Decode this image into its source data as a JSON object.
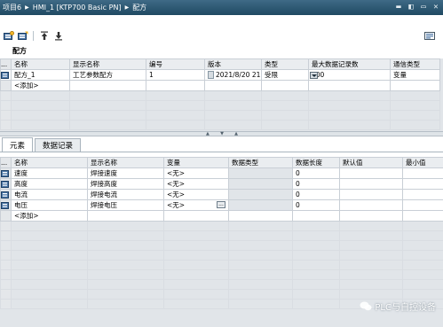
{
  "breadcrumb": {
    "items": [
      "项目6",
      "HMI_1 [KTP700 Basic PN]",
      "配方"
    ]
  },
  "window_controls": {
    "minimize": "▬",
    "restore": "◧",
    "maximize": "▭",
    "close": "✕"
  },
  "toolbar": {
    "buttons": [
      {
        "icon": "add-recipe-icon"
      },
      {
        "icon": "add-element-icon"
      },
      {
        "icon": "move-up-icon"
      },
      {
        "icon": "move-down-icon"
      }
    ]
  },
  "recipes": {
    "section_title": "配方",
    "columns": [
      "...",
      "名称",
      "显示名称",
      "编号",
      "版本",
      "类型",
      "最大数据记录数",
      "通信类型"
    ],
    "rows": [
      {
        "name": "配方_1",
        "display_name": "工艺参数配方",
        "number": "1",
        "version": "2021/8/20 21:1...",
        "type": "受限",
        "max_records": "100",
        "comm_type": "变量"
      }
    ],
    "add_label": "<添加>"
  },
  "tabs": [
    {
      "label": "元素",
      "active": true
    },
    {
      "label": "数据记录",
      "active": false
    }
  ],
  "elements": {
    "columns": [
      "...",
      "名称",
      "显示名称",
      "变量",
      "数据类型",
      "数据长度",
      "默认值",
      "最小值"
    ],
    "rows": [
      {
        "name": "速度",
        "display_name": "焊接速度",
        "tag": "<无>",
        "data_type": "",
        "length": "0",
        "default": "",
        "min": ""
      },
      {
        "name": "高度",
        "display_name": "焊接高度",
        "tag": "<无>",
        "data_type": "",
        "length": "0",
        "default": "",
        "min": ""
      },
      {
        "name": "电流",
        "display_name": "焊接电流",
        "tag": "<无>",
        "data_type": "",
        "length": "0",
        "default": "",
        "min": ""
      },
      {
        "name": "电压",
        "display_name": "焊接电压",
        "tag": "<无>",
        "data_type": "",
        "length": "0",
        "default": "",
        "min": "",
        "selected": true
      }
    ],
    "add_label": "<添加>",
    "ellipsis_button": "..."
  },
  "watermark": "PLC与自控设备",
  "colors": {
    "titlebar": "#2b5671",
    "grid_header": "#eaedf0",
    "grid_border": "#c9cfd6",
    "empty_area": "#e1e5e9"
  }
}
